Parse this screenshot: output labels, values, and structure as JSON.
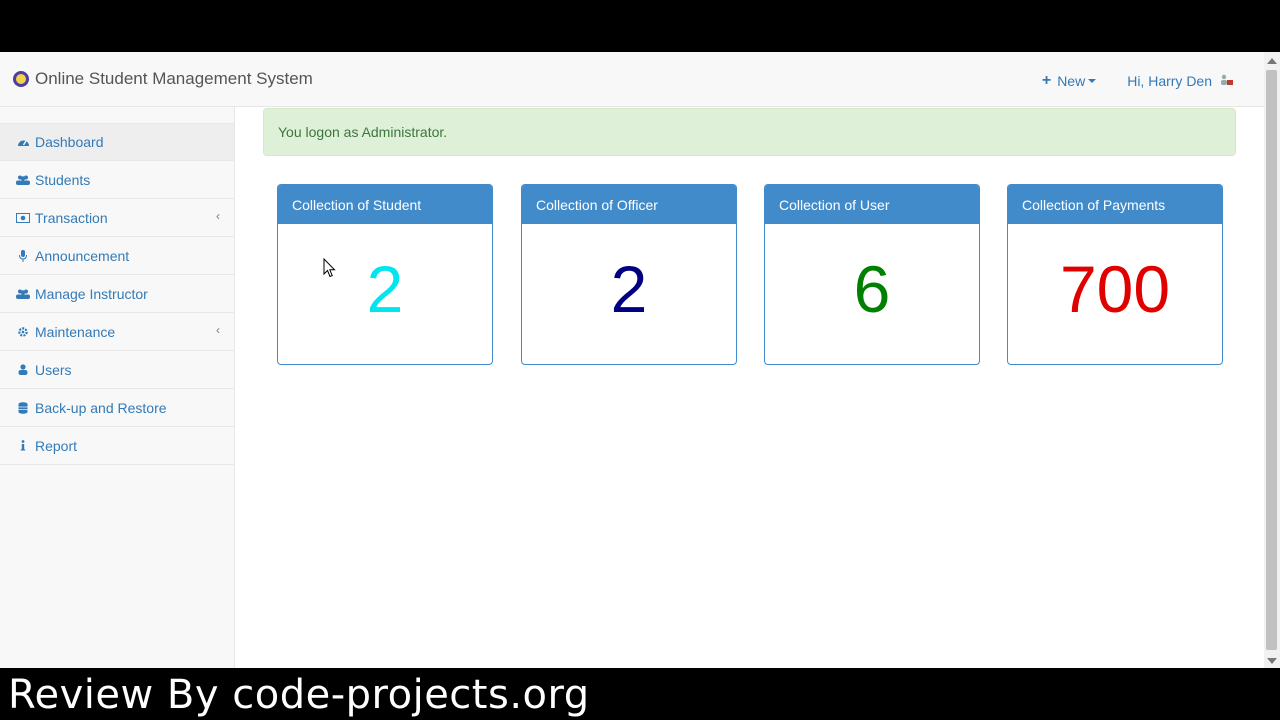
{
  "app": {
    "title": "Online Student Management System"
  },
  "navbar": {
    "new_label": "New",
    "user_greeting": "Hi, Harry Den"
  },
  "sidebar": {
    "items": [
      {
        "label": "Dashboard",
        "icon": "dashboard-icon",
        "active": true
      },
      {
        "label": "Students",
        "icon": "users-icon"
      },
      {
        "label": "Transaction",
        "icon": "money-icon",
        "has_submenu": true
      },
      {
        "label": "Announcement",
        "icon": "microphone-icon"
      },
      {
        "label": "Manage Instructor",
        "icon": "users-icon"
      },
      {
        "label": "Maintenance",
        "icon": "gear-icon",
        "has_submenu": true
      },
      {
        "label": "Users",
        "icon": "user-icon"
      },
      {
        "label": "Back-up and Restore",
        "icon": "database-icon"
      },
      {
        "label": "Report",
        "icon": "info-icon"
      }
    ]
  },
  "alert": {
    "message": "You logon as Administrator."
  },
  "panels": [
    {
      "title": "Collection of Student",
      "value": "2",
      "color": "#00e5ee"
    },
    {
      "title": "Collection of Officer",
      "value": "2",
      "color": "#000080"
    },
    {
      "title": "Collection of User",
      "value": "6",
      "color": "#008000"
    },
    {
      "title": "Collection of Payments",
      "value": "700",
      "color": "#e00000"
    }
  ],
  "watermark": "Review By code-projects.org",
  "colors": {
    "accent": "#337ab7",
    "panel_header": "#428bca",
    "alert_bg": "#dff0d8"
  }
}
